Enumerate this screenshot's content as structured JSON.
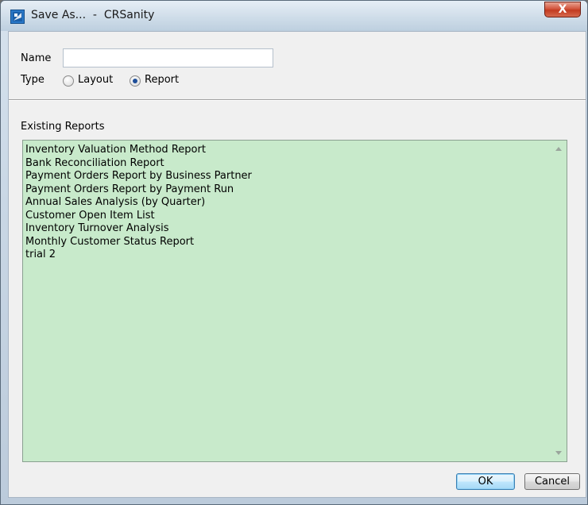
{
  "window": {
    "title": "Save As...  -  CRSanity",
    "close_glyph": "X"
  },
  "form": {
    "name_label": "Name",
    "name_value": "",
    "type_label": "Type",
    "type_options": [
      {
        "label": "Layout",
        "selected": false
      },
      {
        "label": "Report",
        "selected": true
      }
    ]
  },
  "existing": {
    "label": "Existing Reports",
    "items": [
      "Inventory Valuation Method Report",
      "Bank Reconciliation Report",
      "Payment Orders Report by Business Partner",
      "Payment Orders Report by Payment Run",
      "Annual Sales Analysis (by Quarter)",
      "Customer Open Item List",
      "Inventory Turnover Analysis",
      "Monthly Customer Status Report",
      "trial 2"
    ]
  },
  "buttons": {
    "ok_label": "OK",
    "cancel_label": "Cancel"
  },
  "colors": {
    "list_background": "#c8eacb",
    "close_button": "#c23a20"
  },
  "icons": {
    "app": "crsanity-app-icon",
    "scroll_up": "scroll-up-arrow-icon",
    "scroll_down": "scroll-down-arrow-icon"
  }
}
